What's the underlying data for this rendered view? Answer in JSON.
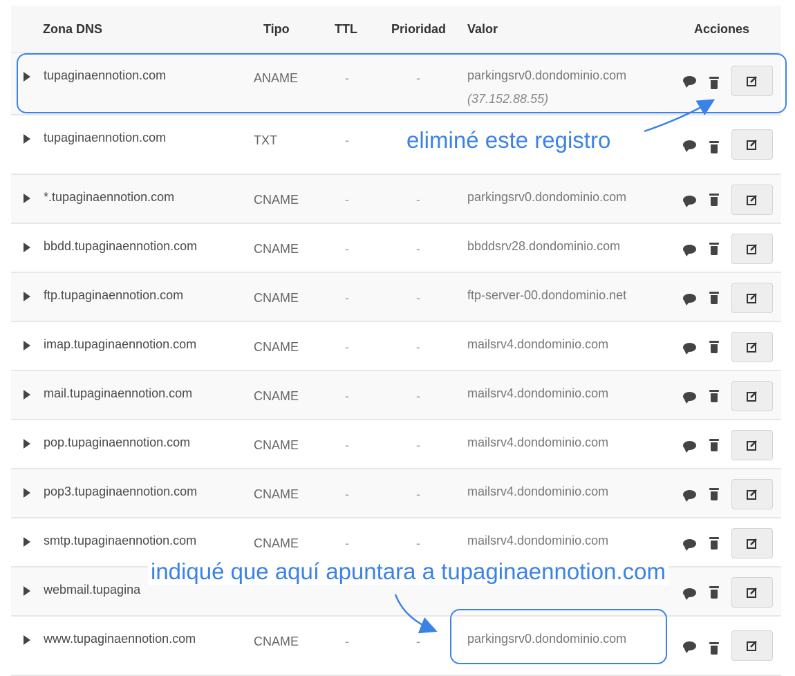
{
  "table": {
    "headers": {
      "zona": "Zona DNS",
      "tipo": "Tipo",
      "ttl": "TTL",
      "prioridad": "Prioridad",
      "valor": "Valor",
      "acciones": "Acciones"
    },
    "rows": [
      {
        "zona": "tupaginaennotion.com",
        "tipo": "ANAME",
        "ttl": "-",
        "prioridad": "-",
        "valor": "parkingsrv0.dondominio.com",
        "valor_ip": "(37.152.88.55)"
      },
      {
        "zona": "tupaginaennotion.com",
        "tipo": "TXT",
        "ttl": "-",
        "prioridad": "-",
        "valor": ""
      },
      {
        "zona": "*.tupaginaennotion.com",
        "tipo": "CNAME",
        "ttl": "-",
        "prioridad": "-",
        "valor": "parkingsrv0.dondominio.com"
      },
      {
        "zona": "bbdd.tupaginaennotion.com",
        "tipo": "CNAME",
        "ttl": "-",
        "prioridad": "-",
        "valor": "bbddsrv28.dondominio.com"
      },
      {
        "zona": "ftp.tupaginaennotion.com",
        "tipo": "CNAME",
        "ttl": "-",
        "prioridad": "-",
        "valor": "ftp-server-00.dondominio.net"
      },
      {
        "zona": "imap.tupaginaennotion.com",
        "tipo": "CNAME",
        "ttl": "-",
        "prioridad": "-",
        "valor": "mailsrv4.dondominio.com"
      },
      {
        "zona": "mail.tupaginaennotion.com",
        "tipo": "CNAME",
        "ttl": "-",
        "prioridad": "-",
        "valor": "mailsrv4.dondominio.com"
      },
      {
        "zona": "pop.tupaginaennotion.com",
        "tipo": "CNAME",
        "ttl": "-",
        "prioridad": "-",
        "valor": "mailsrv4.dondominio.com"
      },
      {
        "zona": "pop3.tupaginaennotion.com",
        "tipo": "CNAME",
        "ttl": "-",
        "prioridad": "-",
        "valor": "mailsrv4.dondominio.com"
      },
      {
        "zona": "smtp.tupaginaennotion.com",
        "tipo": "CNAME",
        "ttl": "-",
        "prioridad": "-",
        "valor": "mailsrv4.dondominio.com"
      },
      {
        "zona": "webmail.tupagina",
        "tipo": "",
        "ttl": "",
        "prioridad": "",
        "valor": ""
      },
      {
        "zona": "www.tupaginaennotion.com",
        "tipo": "CNAME",
        "ttl": "-",
        "prioridad": "-",
        "valor": "parkingsrv0.dondominio.com"
      }
    ]
  },
  "annotations": {
    "deleted_note": "eliminé este registro",
    "pointed_note": "indiqué que aquí apuntara a tupaginaennotion.com"
  },
  "icons": {
    "caret": "caret-right-icon",
    "comment": "comment-icon",
    "trash": "trash-icon",
    "edit": "edit-icon"
  },
  "colors": {
    "annotation": "#3b82e8",
    "row_alt": "#f9f9f9",
    "header_bg": "#f7f7f7"
  }
}
